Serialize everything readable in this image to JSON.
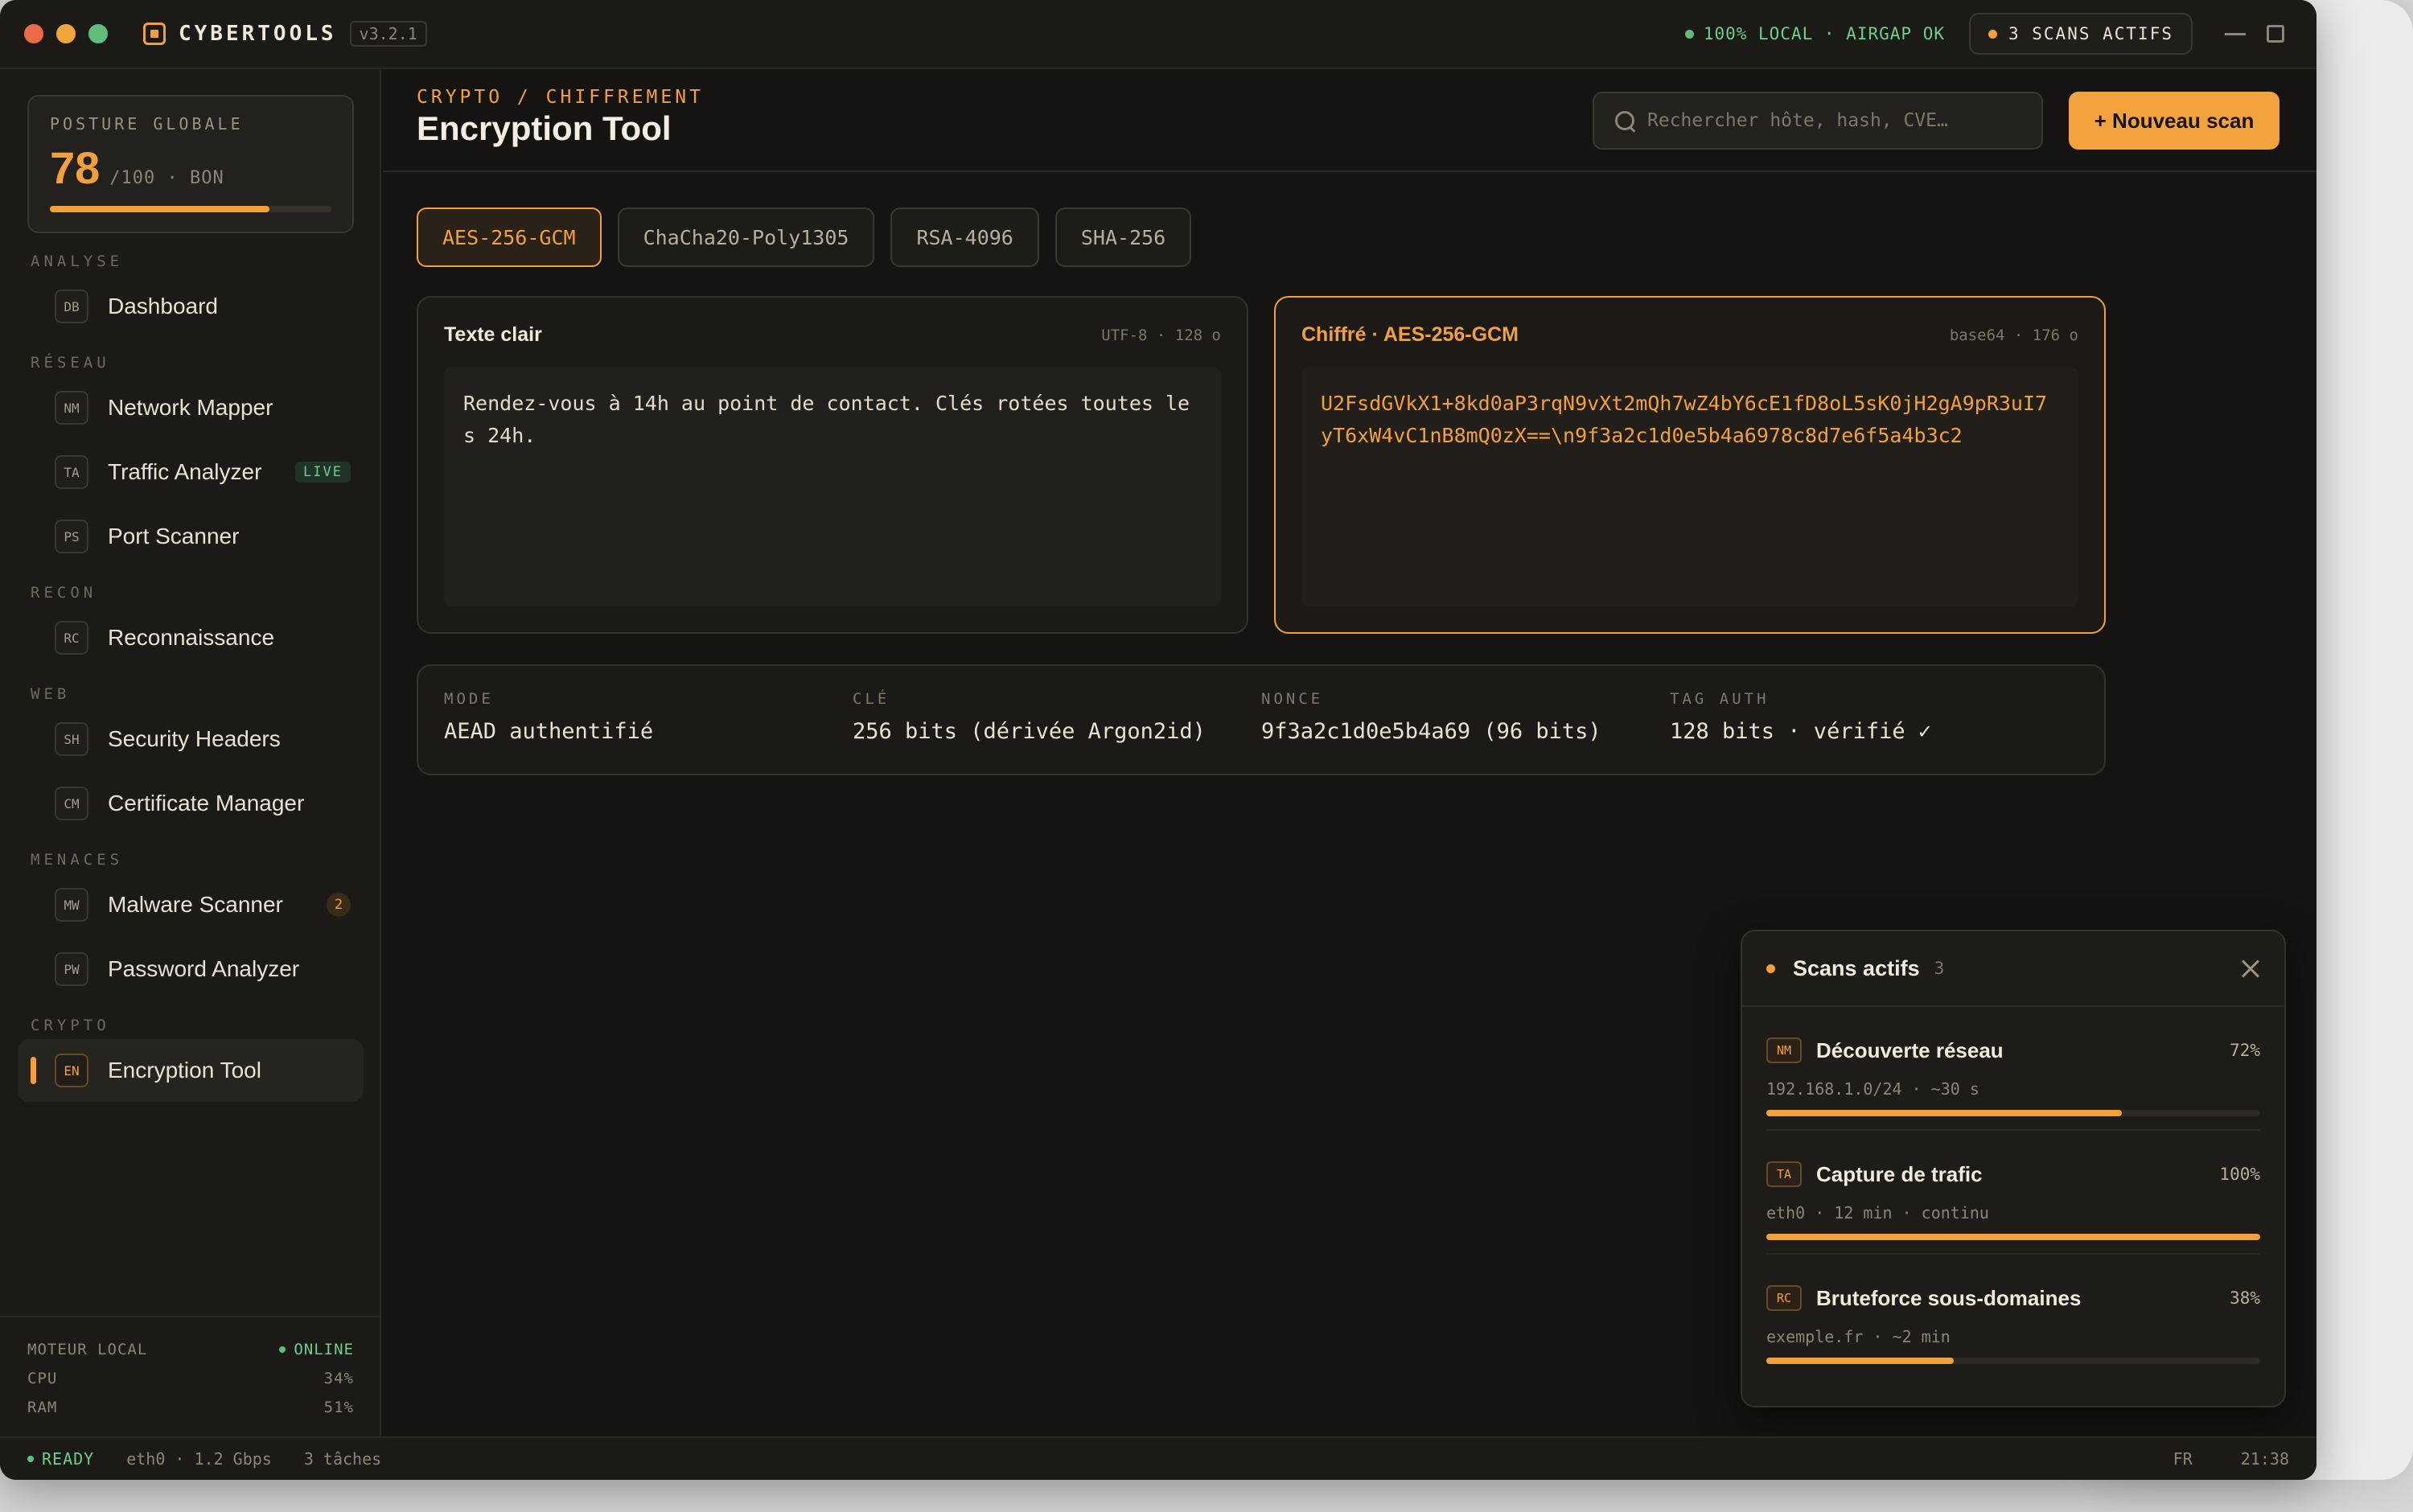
{
  "app": {
    "name": "CYBERTOOLS",
    "version": "v3.2.1",
    "local_status": "100% LOCAL · AIRGAP OK",
    "active_scans_label": "3 SCANS ACTIFS"
  },
  "sidebar": {
    "posture": {
      "label": "POSTURE GLOBALE",
      "score": "78",
      "suffix": "/100 · BON",
      "level": 0.78
    },
    "sections": [
      {
        "title": "ANALYSE",
        "items": [
          {
            "abbr": "DB",
            "label": "Dashboard"
          }
        ]
      },
      {
        "title": "RÉSEAU",
        "items": [
          {
            "abbr": "NM",
            "label": "Network Mapper"
          },
          {
            "abbr": "TA",
            "label": "Traffic Analyzer",
            "badge": "LIVE"
          },
          {
            "abbr": "PS",
            "label": "Port Scanner"
          }
        ]
      },
      {
        "title": "RECON",
        "items": [
          {
            "abbr": "RC",
            "label": "Reconnaissance"
          }
        ]
      },
      {
        "title": "WEB",
        "items": [
          {
            "abbr": "SH",
            "label": "Security Headers"
          },
          {
            "abbr": "CM",
            "label": "Certificate Manager"
          }
        ]
      },
      {
        "title": "MENACES",
        "items": [
          {
            "abbr": "MW",
            "label": "Malware Scanner",
            "count": "2"
          },
          {
            "abbr": "PW",
            "label": "Password Analyzer"
          }
        ]
      },
      {
        "title": "CRYPTO",
        "items": [
          {
            "abbr": "EN",
            "label": "Encryption Tool"
          }
        ]
      }
    ],
    "engine": {
      "label": "MOTEUR LOCAL",
      "status": "ONLINE",
      "cpu_label": "CPU",
      "cpu_value": "34%",
      "ram_label": "RAM",
      "ram_value": "51%"
    }
  },
  "header": {
    "breadcrumb": "CRYPTO / CHIFFREMENT",
    "title": "Encryption Tool",
    "search_placeholder": "Rechercher hôte, hash, CVE…",
    "new_scan_label": "+ Nouveau scan"
  },
  "algorithms": {
    "tabs": [
      "AES-256-GCM",
      "ChaCha20-Poly1305",
      "RSA-4096",
      "SHA-256"
    ],
    "selected": "AES-256-GCM"
  },
  "plaintext": {
    "title": "Texte clair",
    "meta": "UTF-8 · 128 o",
    "content": "Rendez-vous à 14h au point de contact. Clés rotées toutes les 24h."
  },
  "ciphertext": {
    "title": "Chiffré · AES-256-GCM",
    "meta": "base64 · 176 o",
    "content": "U2FsdGVkX1+8kd0aP3rqN9vXt2mQh7wZ4bY6cE1fD8oL5sK0jH2gA9pR3uI7yT6xW4vC1nB8mQ0zX==\\n9f3a2c1d0e5b4a6978c8d7e6f5a4b3c2"
  },
  "details": [
    {
      "label": "MODE",
      "value": "AEAD authentifié"
    },
    {
      "label": "CLÉ",
      "value": "256 bits (dérivée Argon2id)"
    },
    {
      "label": "NONCE",
      "value": "9f3a2c1d0e5b4a69 (96 bits)"
    },
    {
      "label": "TAG AUTH",
      "value": "128 bits · vérifié ✓"
    }
  ],
  "scans_panel": {
    "title": "Scans actifs",
    "count": "3",
    "items": [
      {
        "abbr": "NM",
        "name": "Découverte réseau",
        "percent": "72%",
        "progress": 0.72,
        "detail": "192.168.1.0/24 · ~30 s"
      },
      {
        "abbr": "TA",
        "name": "Capture de trafic",
        "percent": "100%",
        "progress": 1.0,
        "detail": "eth0 · 12 min · continu"
      },
      {
        "abbr": "RC",
        "name": "Bruteforce sous-domaines",
        "percent": "38%",
        "progress": 0.38,
        "detail": "exemple.fr · ~2 min"
      }
    ]
  },
  "statusbar": {
    "ready": "READY",
    "interface": "eth0 · 1.2 Gbps",
    "tasks": "3 tâches",
    "lang": "FR",
    "time": "21:38"
  },
  "colors": {
    "accent": "#f2a03c",
    "success": "#5fbf7a",
    "background": "#151412"
  }
}
